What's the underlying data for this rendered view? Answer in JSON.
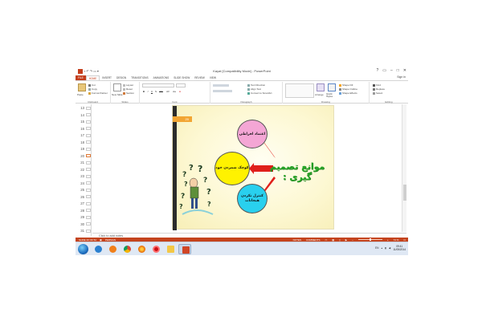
{
  "window": {
    "title": "Kayat [Compatibility Mode] - PowerPoint",
    "sign_in": "Sign in",
    "qat_icons": [
      "save-icon",
      "undo-icon",
      "redo-icon",
      "start-slideshow-icon",
      "customize-qat-icon"
    ],
    "controls": [
      "?",
      "▭",
      "–",
      "□",
      "✕"
    ]
  },
  "tabs": [
    "FILE",
    "HOME",
    "INSERT",
    "DESIGN",
    "TRANSITIONS",
    "ANIMATIONS",
    "SLIDE SHOW",
    "REVIEW",
    "VIEW"
  ],
  "active_tab": "HOME",
  "ribbon": {
    "clipboard": {
      "label": "Clipboard",
      "paste": "Paste",
      "cut": "Cut",
      "copy": "Copy",
      "format_painter": "Format Painter"
    },
    "slides": {
      "label": "Slides",
      "new_slide": "New Slide",
      "layout": "Layout",
      "reset": "Reset",
      "section": "Section"
    },
    "font": {
      "label": "Font",
      "buttons": [
        "B",
        "I",
        "U",
        "S",
        "abc",
        "AV",
        "Aa",
        "A"
      ]
    },
    "paragraph": {
      "label": "Paragraph",
      "text_direction": "Text Direction",
      "align_text": "Align Text",
      "convert_smartart": "Convert to SmartArt"
    },
    "drawing": {
      "label": "Drawing",
      "arrange": "Arrange",
      "quick_styles": "Quick Styles",
      "shape_fill": "Shape Fill",
      "shape_outline": "Shape Outline",
      "shape_effects": "Shape Effects"
    },
    "editing": {
      "label": "Editing",
      "find": "Find",
      "replace": "Replace",
      "select": "Select"
    }
  },
  "thumbnails": {
    "numbers": [
      "13",
      "14",
      "15",
      "16",
      "17",
      "18",
      "19",
      "20",
      "21",
      "22",
      "23",
      "24",
      "25",
      "26",
      "27",
      "28",
      "29",
      "30",
      "31"
    ],
    "selected": "20"
  },
  "slide": {
    "number_tag": "20",
    "title": "موانع تصمیم گیری :",
    "circle_top": "اعتماد افراطی",
    "circle_left": "کوچک شمردن خود",
    "circle_bottom": "کنترل نکردن هیجانات",
    "colors": {
      "title": "#2aa62a",
      "arrows": "#e0201b",
      "pink": "#f4a6d5",
      "yellow": "#fff200",
      "cyan": "#29d0ee"
    }
  },
  "notes_placeholder": "Click to add notes",
  "status": {
    "slide_info": "SLIDE 20 OF 52",
    "language": "PERSIAN",
    "notes": "NOTES",
    "comments": "COMMENTS",
    "zoom": "74 %"
  },
  "taskbar": {
    "apps": [
      "windows-explorer-icon",
      "media-player-icon",
      "chrome-icon",
      "firefox-icon",
      "opera-icon",
      "folder-icon",
      "powerpoint-icon"
    ],
    "tray_lang": "EN",
    "time": "09:41",
    "date": "11/05/2014"
  }
}
